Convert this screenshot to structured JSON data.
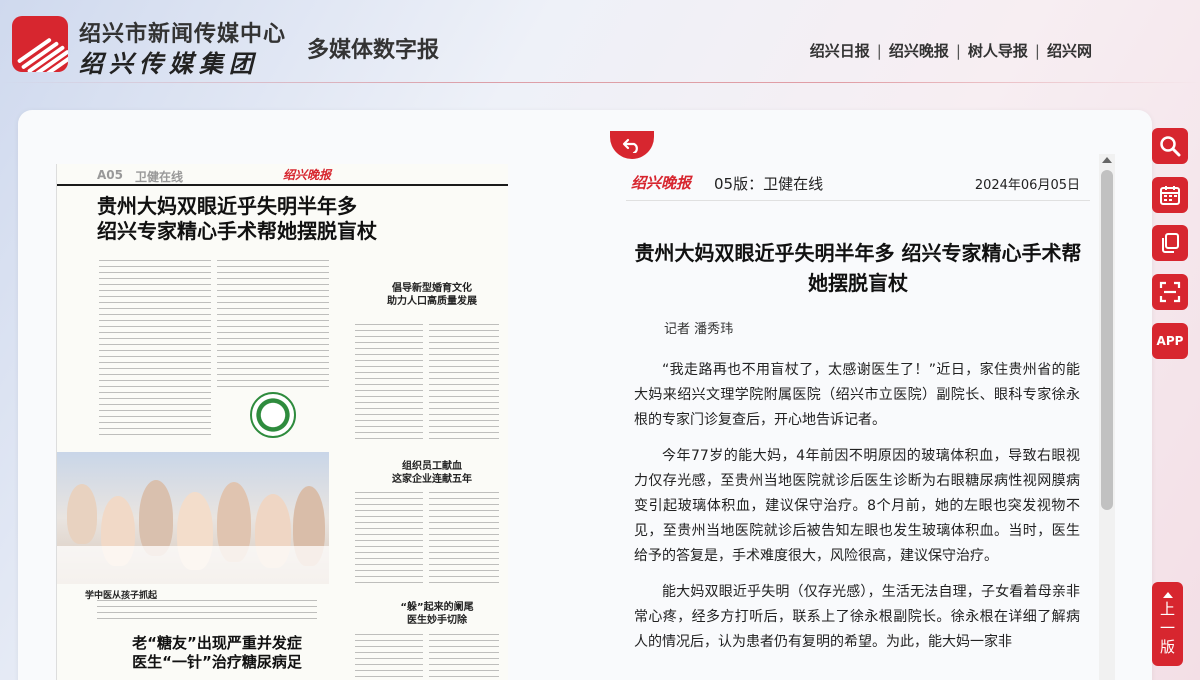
{
  "header": {
    "org_name": "绍兴市新闻传媒中心",
    "group_name": "绍兴传媒集团",
    "app_name": "多媒体数字报",
    "nav": [
      {
        "label": "绍兴日报"
      },
      {
        "label": "绍兴晚报"
      },
      {
        "label": "树人导报"
      },
      {
        "label": "绍兴网"
      }
    ],
    "nav_separator": "|"
  },
  "colors": {
    "accent": "#d7262f",
    "text": "#222222"
  },
  "page_image": {
    "page_number": "A05",
    "section": "卫健在线",
    "brand": "绍兴晚报",
    "headline_line1": "贵州大妈双眼近乎失明半年多",
    "headline_line2": "绍兴专家精心手术帮她摆脱盲杖",
    "sub1_line1": "倡导新型婚育文化",
    "sub1_line2": "助力人口高质量发展",
    "sub2_line1": "组织员工献血",
    "sub2_line2": "这家企业连献五年",
    "photo_caption": "学中医从孩子抓起",
    "headline2_line1": "老“糖友”出现严重并发症",
    "headline2_line2": "医生“一针”治疗糖尿病足",
    "sub3_line1": "“躲”起来的阑尾",
    "sub3_line2": "医生妙手切除"
  },
  "article": {
    "brand": "绍兴晚报",
    "section": "05版：卫健在线",
    "date": "2024年06月05日",
    "title": "贵州大妈双眼近乎失明半年多 绍兴专家精心手术帮她摆脱盲杖",
    "author": "记者  潘秀玮",
    "paragraphs": [
      "“我走路再也不用盲杖了，太感谢医生了！”近日，家住贵州省的能大妈来绍兴文理学院附属医院（绍兴市立医院）副院长、眼科专家徐永根的专家门诊复查后，开心地告诉记者。",
      "今年77岁的能大妈，4年前因不明原因的玻璃体积血，导致右眼视力仅存光感，至贵州当地医院就诊后医生诊断为右眼糖尿病性视网膜病变引起玻璃体积血，建议保守治疗。8个月前，她的左眼也突发视物不见，至贵州当地医院就诊后被告知左眼也发生玻璃体积血。当时，医生给予的答复是，手术难度很大，风险很高，建议保守治疗。",
      "能大妈双眼近乎失明（仅存光感），生活无法自理，子女看着母亲非常心疼，经多方打听后，联系上了徐永根副院长。徐永根在详细了解病人的情况后，认为患者仍有复明的希望。为此，能大妈一家非"
    ]
  },
  "tools": {
    "search": "search-icon",
    "calendar": "calendar-icon",
    "copy": "copy-icon",
    "scan": "scan-icon",
    "app_label": "APP",
    "back_top_label": [
      "上",
      "一",
      "版"
    ]
  }
}
